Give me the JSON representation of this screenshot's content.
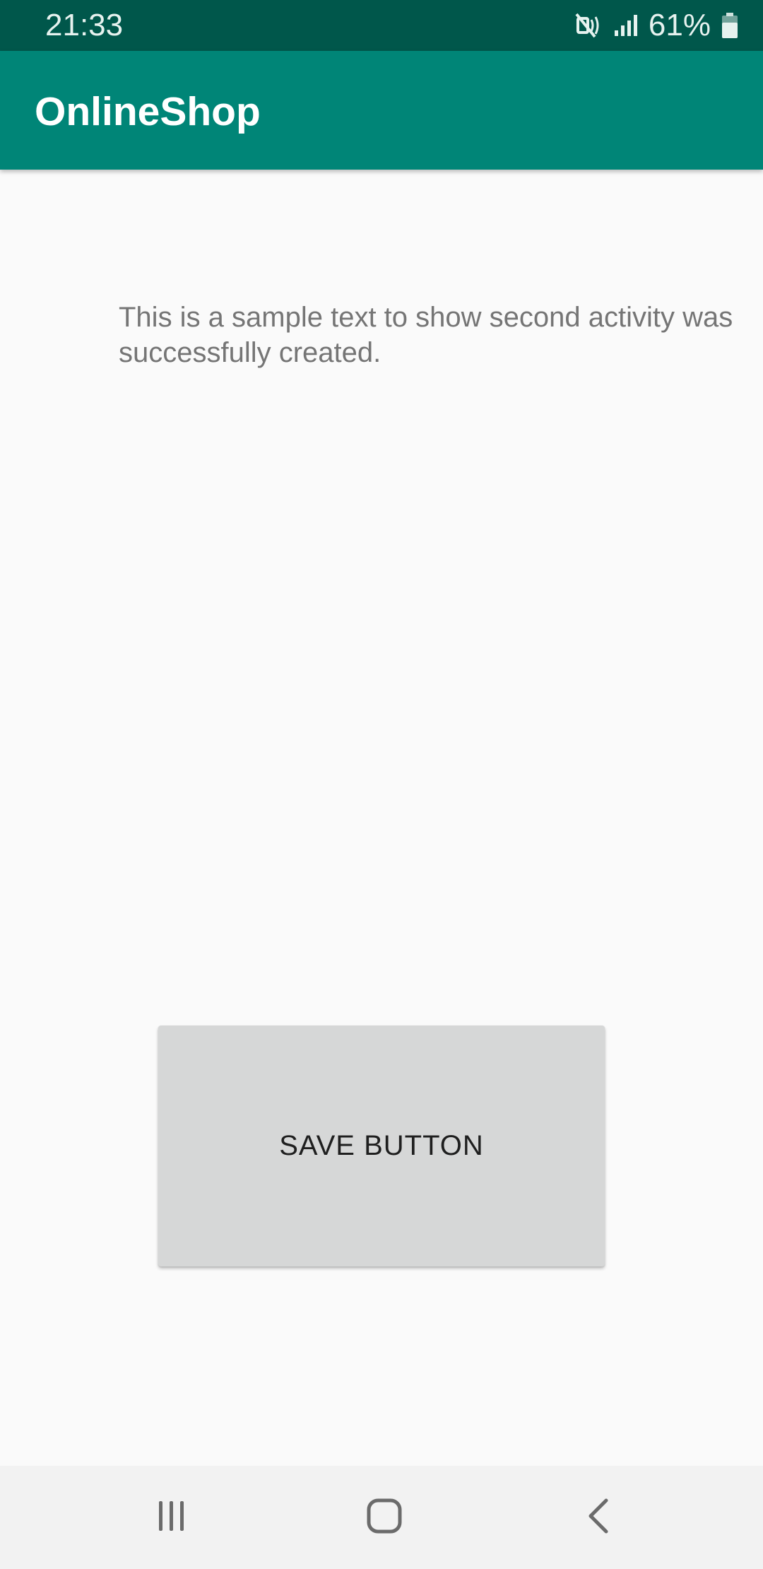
{
  "status_bar": {
    "time": "21:33",
    "battery_percent": "61%",
    "icons": [
      "mute-vibrate-icon",
      "signal-icon",
      "battery-icon"
    ]
  },
  "app_bar": {
    "title": "OnlineShop",
    "color": "#008577"
  },
  "content": {
    "sample_text": "This is a sample text to show second activity was successfully created.",
    "save_button_label": "SAVE BUTTON"
  },
  "nav_bar": {
    "buttons": [
      "recents-icon",
      "home-icon",
      "back-icon"
    ]
  },
  "colors": {
    "status_bar": "#00574b",
    "app_bar": "#008577",
    "background": "#fafafa",
    "button": "#d6d7d7"
  }
}
